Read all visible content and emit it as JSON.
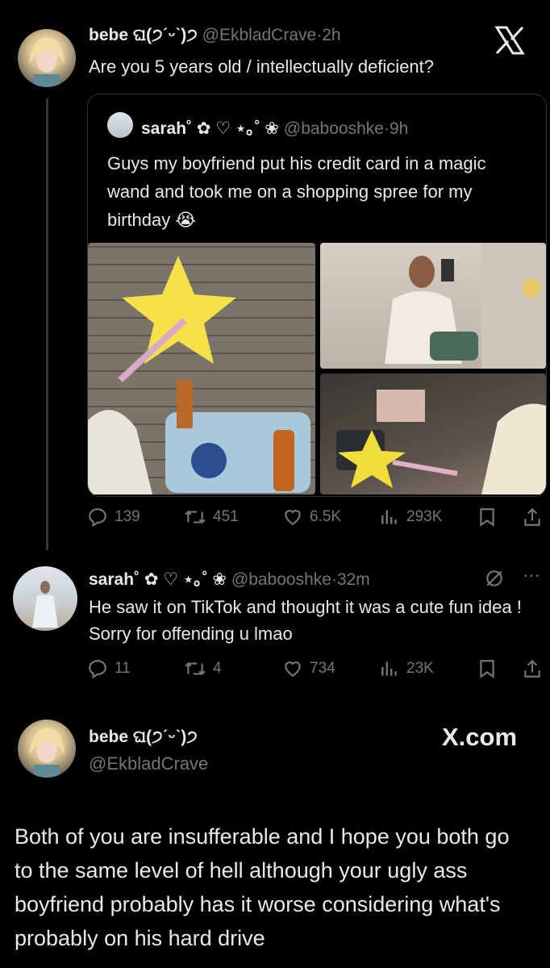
{
  "tweet1": {
    "display_name": "bebe ଘ(੭ˊᵕˋ)੭",
    "handle": "@EkbladCrave",
    "dot": "·",
    "time": "2h",
    "text": "Are you 5 years old / intellectually deficient?",
    "logo": "X"
  },
  "quote": {
    "display_name": "sarah˚ ✿ ♡ ⋆｡˚ ❀",
    "handle": "@babooshke",
    "dot": "·",
    "time": "9h",
    "text": "Guys my boyfriend put his credit card in a magic wand and took me on a shopping spree for my birthday 😭"
  },
  "tweet1_actions": {
    "replies": "139",
    "retweets": "451",
    "likes": "6.5K",
    "views": "293K"
  },
  "tweet2": {
    "display_name": "sarah˚ ✿ ♡ ⋆｡˚ ❀",
    "handle": "@babooshke",
    "dot": "·",
    "time": "32m",
    "text": "He saw it on TikTok and thought it was a cute fun idea ! Sorry for offending u lmao",
    "more": "···"
  },
  "tweet2_actions": {
    "replies": "11",
    "retweets": "4",
    "likes": "734",
    "views": "23K"
  },
  "tweet3": {
    "display_name": "bebe ଘ(੭ˊᵕˋ)੭",
    "handle": "@EkbladCrave",
    "brand": "X.com",
    "text": "Both of you are insufferable and I hope you both go to the same level of hell although your ugly ass boyfriend probably has it worse considering what's probably on his hard drive"
  },
  "colors": {
    "background": "#000000",
    "text": "#e7e9ea",
    "muted": "#71767b",
    "border": "#2f3336"
  }
}
